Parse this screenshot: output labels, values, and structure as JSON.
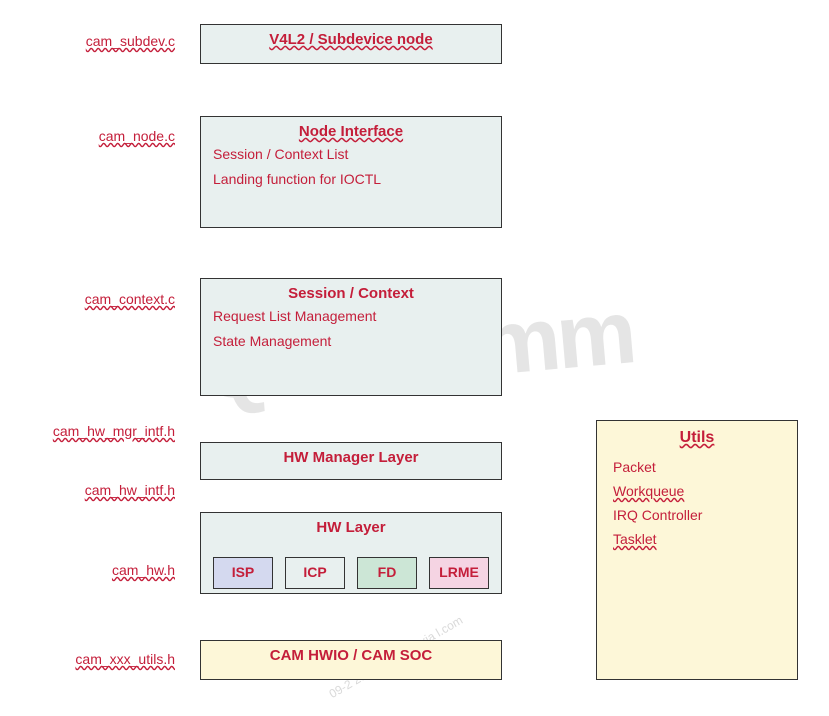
{
  "labels": {
    "subdev": "cam_subdev.c",
    "node": "cam_node.c",
    "context": "cam_context.c",
    "hw_mgr_intf": "cam_hw_mgr_intf.h",
    "hw_intf": "cam_hw_intf.h",
    "hw": "cam_hw.h",
    "utils": "cam_xxx_utils.h"
  },
  "boxes": {
    "subdev": {
      "title": "V4L2 / Subdevice node"
    },
    "node": {
      "title": "Node Interface",
      "line1": "Session / Context List",
      "line2": "Landing function for IOCTL"
    },
    "context": {
      "title": "Session / Context",
      "line1": "Request List Management",
      "line2": "State Management"
    },
    "hw_mgr": {
      "title": "HW Manager Layer"
    },
    "hw_layer": {
      "title": "HW Layer",
      "isp": "ISP",
      "icp": "ICP",
      "fd": "FD",
      "lrme": "LRME"
    },
    "hwio": {
      "title": "CAM HWIO / CAM SOC"
    }
  },
  "utils": {
    "title": "Utils",
    "items": [
      "Packet",
      "Workqueue",
      "IRQ Controller",
      "Tasklet"
    ]
  },
  "watermark": {
    "main": "Qualcomm",
    "small": "09-2  20:00:0 PDT\nexia   l.com"
  }
}
